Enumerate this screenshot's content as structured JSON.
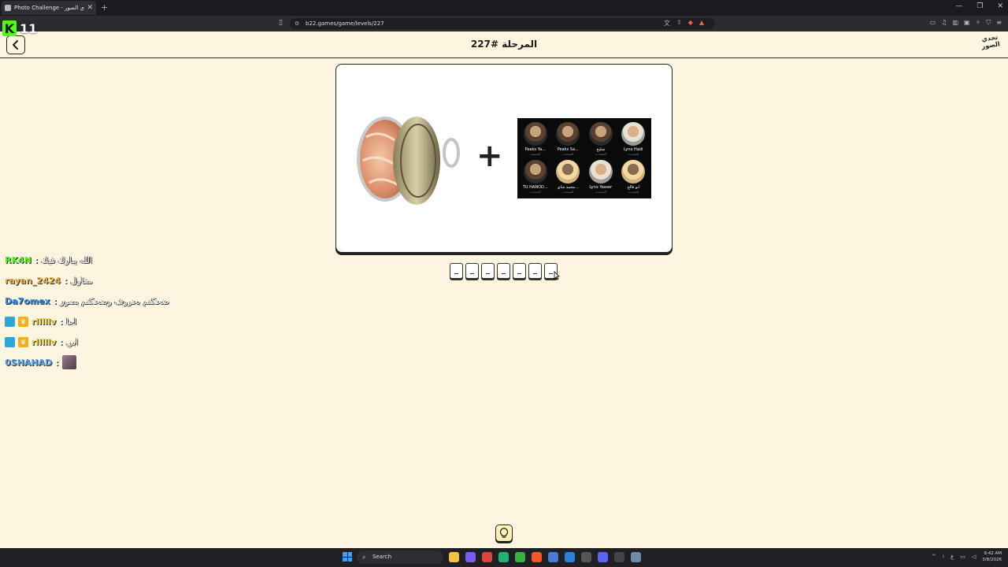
{
  "browser": {
    "tab_title": "Photo Challenge - تحدي الصور",
    "url": "b22.games/game/levels/227"
  },
  "stream_overlay": {
    "viewer_count": "11"
  },
  "page": {
    "level_title": "المرحلة #227",
    "logo_text": "تحدي الصور",
    "answer_slot_count": 7
  },
  "puzzle": {
    "plus_symbol": "+",
    "grid_people": [
      {
        "name": "Peaks Ya...",
        "sub": "المضيف"
      },
      {
        "name": "Peaks Sa...",
        "sub": "المتحدث"
      },
      {
        "name": "صليح",
        "sub": "المتحدث"
      },
      {
        "name": "Lynx Hadi",
        "sub": "المتحدث"
      },
      {
        "name": "TU HANOD...",
        "sub": "المتحدث"
      },
      {
        "name": "محمد شاي...",
        "sub": "المتحدث"
      },
      {
        "name": "Lynx Yasser",
        "sub": "المتحدث"
      },
      {
        "name": "ابو فالح",
        "sub": "المتحدث"
      }
    ]
  },
  "chat": [
    {
      "user": "RK4N",
      "color": "#53fc18",
      "sep": ":",
      "msg": "الله يبارك فيك"
    },
    {
      "user": "rayan_2424",
      "color": "#e8b04a",
      "sep": ":",
      "msg": "مقاول"
    },
    {
      "user": "Da7omex",
      "color": "#3a8ee8",
      "sep": ":",
      "msg": "ضحكتم بحروف وضحكتم بصور"
    },
    {
      "user": "rlllllv",
      "color": "#e8d24a",
      "sep": ":",
      "msg": "احا"
    },
    {
      "user": "rlllllv",
      "color": "#e8d24a",
      "sep": ":",
      "msg": "ابي"
    },
    {
      "user": "0SHAHAD",
      "color": "#5aa8f0",
      "sep": ":",
      "msg": ""
    }
  ],
  "taskbar": {
    "search_placeholder": "Search",
    "time": "9:42 AM",
    "date": "3/8/2026"
  },
  "colors": {
    "page_bg": "#fdf5df",
    "kick_green": "#53fc18"
  }
}
